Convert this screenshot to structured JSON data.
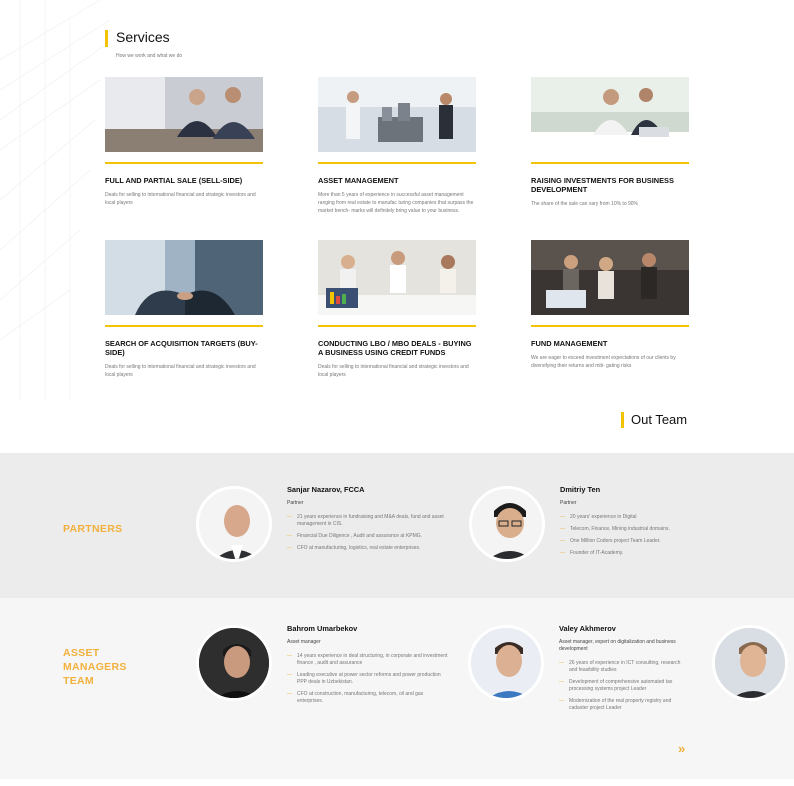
{
  "services": {
    "title": "Services",
    "subtitle": "How we work and what we do",
    "cards": [
      {
        "title": "FULL AND PARTIAL SALE (SELL-SIDE)",
        "desc": "Deals for selling to international financial and strategic investors and local players"
      },
      {
        "title": "ASSET MANAGEMENT",
        "desc": "More than 5 years of experience in successful asset management ranging from real estate to manufac turing companies that surpass the market bench- marks will definitely bring value to your business."
      },
      {
        "title": "RAISING INVESTMENTS FOR BUSINESS DEVELOPMENT",
        "desc": "The share of the sale can vary from 10% to 90%"
      },
      {
        "title": "SEARCH OF ACQUISITION TARGETS (BUY-SIDE)",
        "desc": "Deals for selling to international financial and strategic investors and local players"
      },
      {
        "title": "CONDUCTING LBO / MBO DEALS -  BUYING A BUSINESS USING CREDIT FUNDS",
        "desc": "Deals for selling to international financial and strategic investors and local players"
      },
      {
        "title": "FUND MANAGEMENT",
        "desc": "We are eager to exceed investment expectations  of our clients by diversifying their returns and miti- gating risks"
      }
    ]
  },
  "team": {
    "title": "Out Team",
    "partners_label": "PARTNERS",
    "managers_label_lines": [
      "ASSET",
      "MANAGERS",
      "TEAM"
    ],
    "partners": [
      {
        "name": "Sanjar Nazarov, FCCA",
        "role": "Partner",
        "points": [
          "21 years experience in fundraising and M&A deals, fund and asset management in CIS.",
          "Financial Due Diligence , Audit and assurance at KPMG.",
          "CFO at manufacturing, logistics, real estate  enterprises."
        ]
      },
      {
        "name": "Dmitriy Ten",
        "role": "Partner",
        "points": [
          "20 years' experience in Digital",
          "Telecom, Finance, Mining industrial domains.",
          "One Million Coders project Team Leader.",
          "Founder of IT-Academy."
        ]
      }
    ],
    "managers": [
      {
        "name": "Bahrom Umarbekov",
        "role": "Asset manager",
        "points": [
          "14 years  experience in deal structuring, in  corporate and investment finance , audit and  assurance",
          "Leading executive at power sector reforms and  power production PPP deals in Uzbekistan.",
          "CFO at construction, manufacturing, telecom,  oil and gas enterprises."
        ]
      },
      {
        "name": "Valey Akhmerov",
        "role": "Asset manager, expert on digitalization and business development",
        "points": [
          "26 years of experience in ICT consulting, research and feasibility studies",
          "Development of comprehensive automated tax  processing systems project Leader",
          "Modernization of the real property registry and  cadaster project Leader"
        ]
      }
    ],
    "next_label": "»"
  },
  "colors": {
    "accent": "#f2c300",
    "label": "#f2b03c",
    "band_dark": "#ececec",
    "band_light": "#f6f6f6"
  }
}
